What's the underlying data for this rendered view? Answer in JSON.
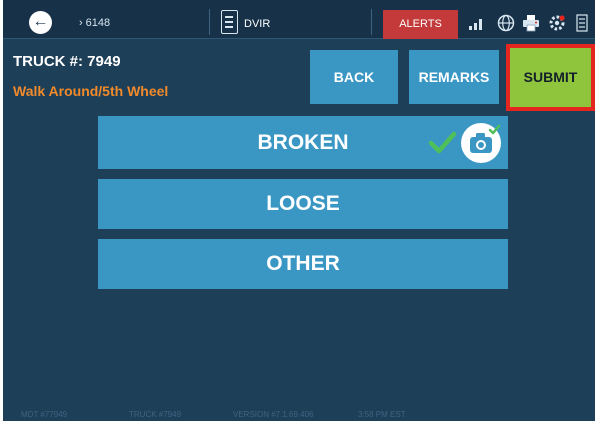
{
  "topbar": {
    "back_glyph": "←",
    "breadcrumb_chevron": "›",
    "breadcrumb_value": "6148",
    "module_label": "DVIR",
    "alerts_label": "ALERTS",
    "alerts_color": "#c43a3a",
    "tray_icons": [
      "signal-icon",
      "globe-icon",
      "printer-icon",
      "settings-icon",
      "menu-icon"
    ]
  },
  "header": {
    "truck_label": "TRUCK #: 7949",
    "inspection_area": "Walk Around/5th Wheel"
  },
  "toolbar": {
    "back_label": "BACK",
    "remarks_label": "REMARKS",
    "submit_label": "SUBMIT"
  },
  "options": [
    {
      "label": "BROKEN",
      "checked": true,
      "has_photo": true
    },
    {
      "label": "LOOSE",
      "checked": false,
      "has_photo": false
    },
    {
      "label": "OTHER",
      "checked": false,
      "has_photo": false
    }
  ],
  "footer": {
    "mdt": "MDT #77949",
    "truck": "TRUCK #7949",
    "version": "VERSION #7.1.69.406",
    "time": "3:58 PM EST"
  },
  "colors": {
    "background": "#1e3f58",
    "button": "#3a97c4",
    "accent_orange": "#f08a2a",
    "submit_green": "#8fc43d",
    "highlight_red": "#e5261e",
    "check_green": "#4fbf5a"
  }
}
